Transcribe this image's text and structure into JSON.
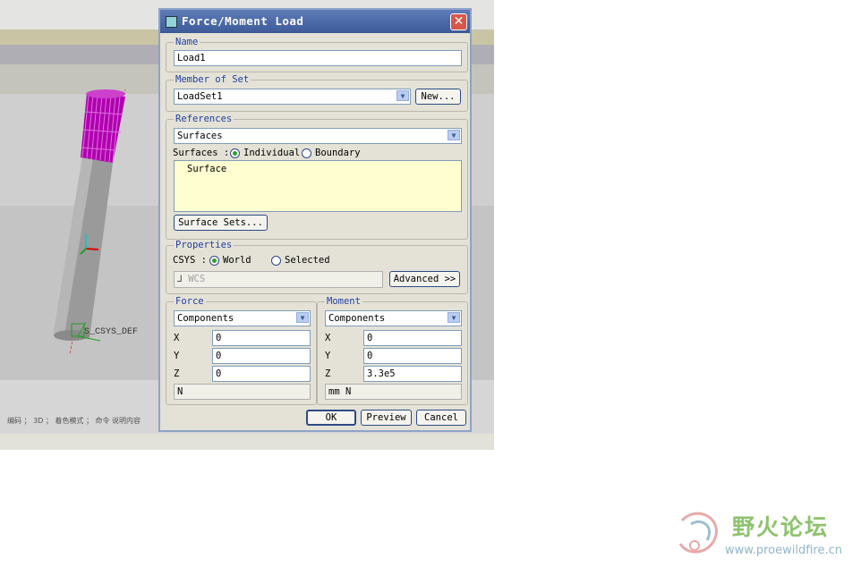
{
  "viewport": {
    "csys_label": "S_CSYS_DEF",
    "status_text": "编码 ； 3D ； 着色模式 ； 命令 说明内容"
  },
  "dialog": {
    "title": "Force/Moment Load",
    "name_group": {
      "label": "Name",
      "value": "Load1"
    },
    "member_group": {
      "label": "Member of Set",
      "value": "LoadSet1",
      "new_button": "New..."
    },
    "references_group": {
      "label": "References",
      "type_value": "Surfaces",
      "surfaces_label": "Surfaces :",
      "option_individual": "Individual",
      "option_boundary": "Boundary",
      "selected_option": "Individual",
      "list_items": [
        "Surface"
      ],
      "surface_sets_button": "Surface Sets..."
    },
    "properties_group": {
      "label": "Properties",
      "csys_label": "CSYS :",
      "option_world": "World",
      "option_selected": "Selected",
      "selected_option": "World",
      "csys_value": "WCS",
      "advanced_button": "Advanced >>"
    },
    "force_group": {
      "label": "Force",
      "mode": "Components",
      "x_label": "X",
      "x_value": "0",
      "y_label": "Y",
      "y_value": "0",
      "z_label": "Z",
      "z_value": "0",
      "units": "N"
    },
    "moment_group": {
      "label": "Moment",
      "mode": "Components",
      "x_label": "X",
      "x_value": "0",
      "y_label": "Y",
      "y_value": "0",
      "z_label": "Z",
      "z_value": "3.3e5",
      "units": "mm N"
    },
    "buttons": {
      "ok": "OK",
      "preview": "Preview",
      "cancel": "Cancel"
    }
  },
  "watermark": {
    "cn_text": "野火论坛",
    "url": "www.proewildfire.cn"
  },
  "colors": {
    "title_bar": "#4a68a8",
    "dialog_bg": "#e4e2d6",
    "group_label": "#1f3f9f",
    "mesh": "#b000b0",
    "shaft": "#9a9a9a",
    "list_bg": "#fffed0"
  }
}
